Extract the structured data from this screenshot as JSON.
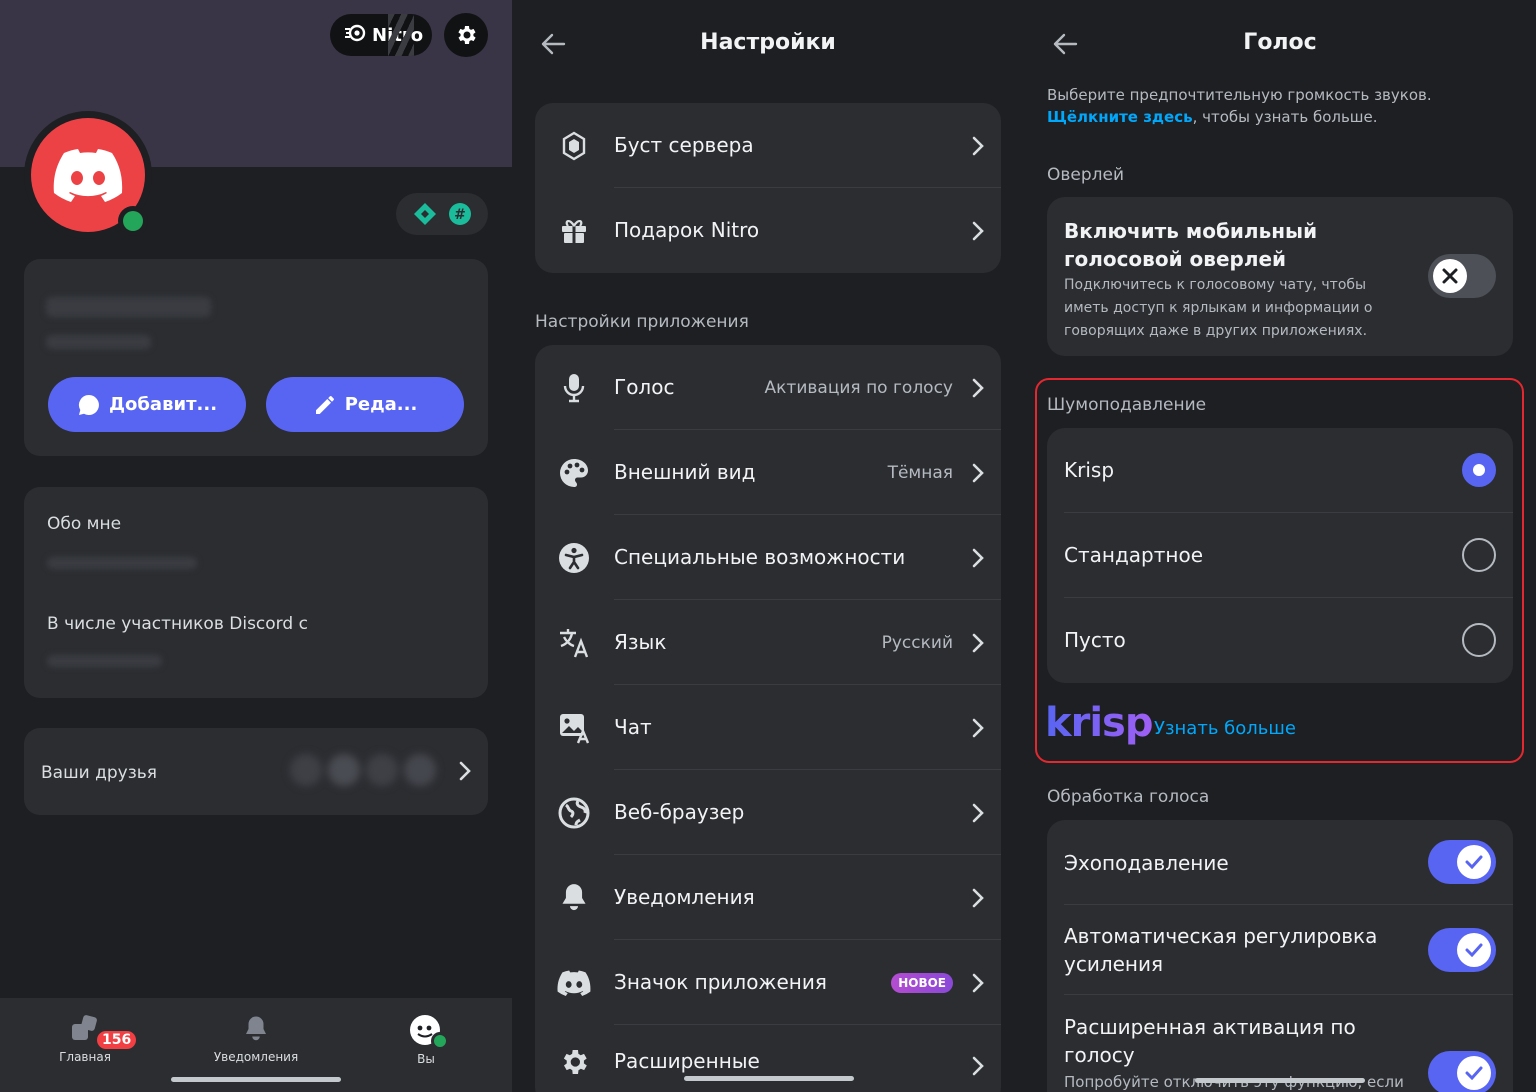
{
  "profile": {
    "nitro_label": "Nitro",
    "add_button": "Добавит...",
    "edit_button": "Реда...",
    "about_label": "Обо мне",
    "member_since_label": "В числе участников Discord с",
    "friends_label": "Ваши друзья"
  },
  "bottom_nav": {
    "home": "Главная",
    "home_badge": "156",
    "notifications": "Уведомления",
    "you": "Вы"
  },
  "settings": {
    "title": "Настройки",
    "top_group": [
      {
        "label": "Буст сервера",
        "icon": "boost-icon"
      },
      {
        "label": "Подарок Nitro",
        "icon": "gift-icon"
      }
    ],
    "app_section_label": "Настройки приложения",
    "app_items": [
      {
        "label": "Голос",
        "value": "Активация по голосу",
        "icon": "microphone-icon"
      },
      {
        "label": "Внешний вид",
        "value": "Тёмная",
        "icon": "palette-icon"
      },
      {
        "label": "Специальные возможности",
        "value": "",
        "icon": "accessibility-icon"
      },
      {
        "label": "Язык",
        "value": "Русский",
        "icon": "language-icon"
      },
      {
        "label": "Чат",
        "value": "",
        "icon": "chat-image-icon"
      },
      {
        "label": "Веб-браузер",
        "value": "",
        "icon": "globe-icon"
      },
      {
        "label": "Уведомления",
        "value": "",
        "icon": "bell-icon"
      },
      {
        "label": "Значок приложения",
        "value": "",
        "badge": "НОВОЕ",
        "icon": "discord-icon"
      },
      {
        "label": "Расширенные",
        "value": "",
        "icon": "gear-icon"
      }
    ]
  },
  "voice": {
    "title": "Голос",
    "intro_text": "Выберите предпочтительную громкость звуков.",
    "intro_link": "Щёлкните здесь",
    "intro_suffix": ", чтобы узнать больше.",
    "overlay_section": "Оверлей",
    "overlay_title": "Включить мобильный голосовой оверлей",
    "overlay_desc": "Подключитесь к голосовому чату, чтобы иметь доступ к ярлыкам и информации о говорящих даже в других приложениях.",
    "noise_section": "Шумоподавление",
    "noise_options": [
      {
        "label": "Krisp",
        "selected": true
      },
      {
        "label": "Стандартное",
        "selected": false
      },
      {
        "label": "Пусто",
        "selected": false
      }
    ],
    "krisp_logo": "krisp",
    "learn_more": "Узнать больше",
    "processing_section": "Обработка голоса",
    "processing_items": [
      {
        "label": "Эхоподавление",
        "on": true
      },
      {
        "label": "Автоматическая регулировка усиления",
        "on": true
      },
      {
        "label": "Расширенная активация по голосу",
        "on": true
      }
    ],
    "advanced_desc": "Попробуйте отключить эту функцию, если"
  },
  "colors": {
    "accent": "#5865f2",
    "danger": "#ed4245",
    "online": "#23a55a",
    "highlight": "#e4282f"
  }
}
